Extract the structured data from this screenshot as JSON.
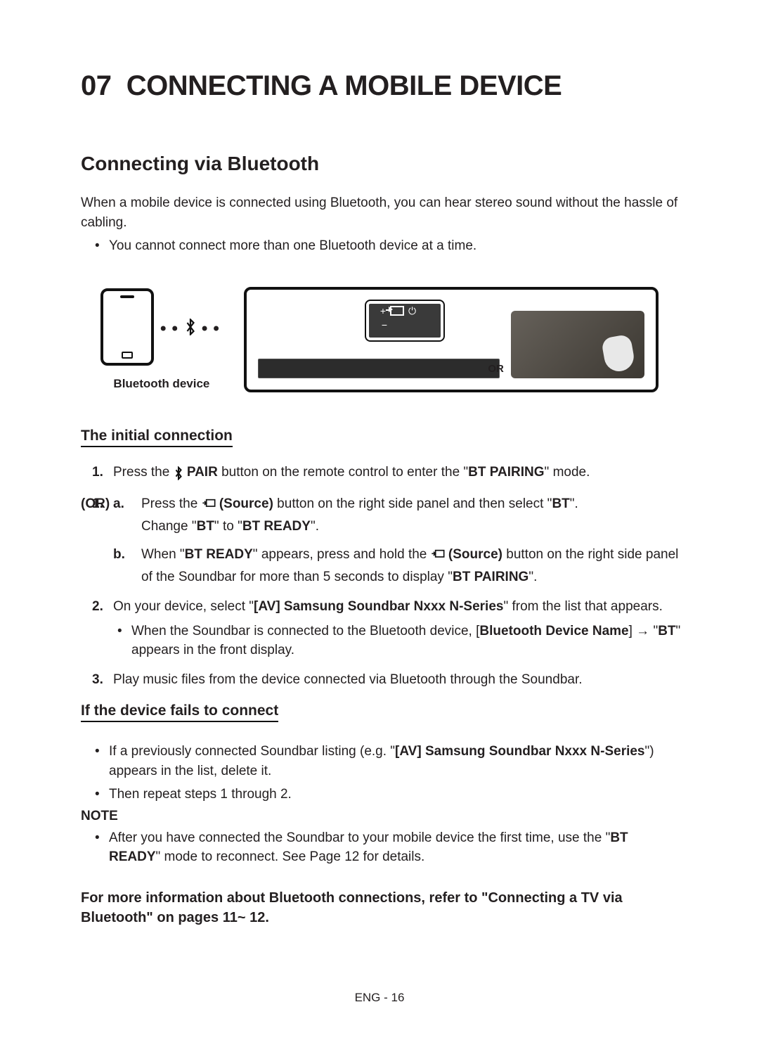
{
  "chapter": {
    "number": "07",
    "title": "CONNECTING A MOBILE DEVICE"
  },
  "section_title": "Connecting via Bluetooth",
  "intro": "When a mobile device is connected using Bluetooth, you can hear stereo sound without the hassle of cabling.",
  "intro_bullet": "You cannot connect more than one Bluetooth device at a time.",
  "diagram": {
    "device_label": "Bluetooth device",
    "or_label": "OR"
  },
  "initial_heading": "The initial connection",
  "step1": {
    "t1": "Press the ",
    "pair_bold": " PAIR",
    "t2": " button on the remote control to enter the \"",
    "bt_pairing": "BT PAIRING",
    "t3": "\" mode."
  },
  "or_label": "(OR)",
  "step_a": {
    "letter": "a.",
    "t1": "Press the ",
    "source_bold": " (Source)",
    "t2": " button on the right side panel and then select \"",
    "bt": "BT",
    "t3": "\".",
    "line2_a": "Change \"",
    "line2_bt": "BT",
    "line2_b": "\" to \"",
    "line2_btready": "BT READY",
    "line2_c": "\"."
  },
  "step_b": {
    "letter": "b.",
    "t1": "When \"",
    "btready": "BT READY",
    "t2": "\" appears, press and hold the ",
    "source_bold": " (Source)",
    "t3": " button on the right side panel of the Soundbar for more than 5 seconds to display \"",
    "bt_pairing": "BT PAIRING",
    "t4": "\"."
  },
  "step2": {
    "t1": "On your device, select \"",
    "av_bold": "[AV] Samsung Soundbar Nxxx N-Series",
    "t2": "\" from the list that appears.",
    "bullet_a": "When the Soundbar is connected to the Bluetooth device, [",
    "bullet_bold1": "Bluetooth Device Name",
    "bullet_b": "] → \"",
    "bullet_bold2": "BT",
    "bullet_c": "\" appears in the front display."
  },
  "step3": "Play music files from the device connected via Bluetooth through the Soundbar.",
  "fails_heading": "If the device fails to connect",
  "fails_b1_a": "If a previously connected Soundbar listing (e.g. \"",
  "fails_b1_bold": "[AV] Samsung Soundbar Nxxx N-Series",
  "fails_b1_b": "\") appears in the list, delete it.",
  "fails_b2": "Then repeat steps 1 through 2.",
  "note_head": "NOTE",
  "note_b1_a": "After you have connected the Soundbar to your mobile device the first time, use the \"",
  "note_b1_bold": "BT READY",
  "note_b1_b": "\" mode to reconnect. See Page 12 for details.",
  "closing": "For more information about Bluetooth connections, refer to \"Connecting a TV via Bluetooth\" on pages 11~ 12.",
  "footer": "ENG - 16"
}
